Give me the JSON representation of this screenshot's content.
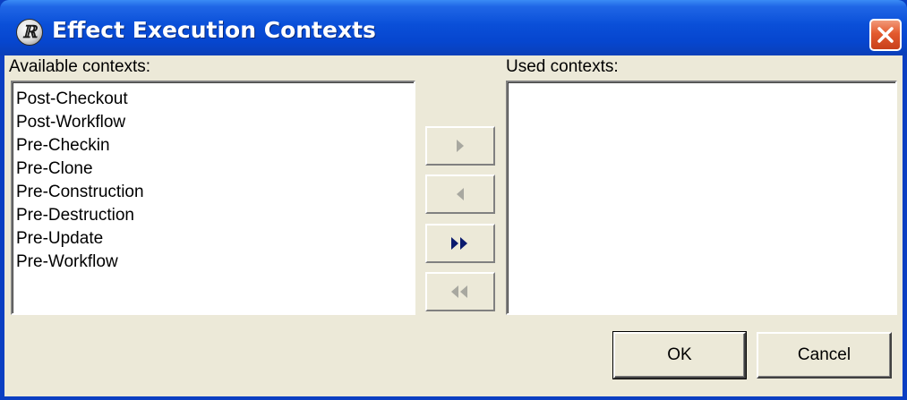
{
  "window": {
    "title": "Effect Execution Contexts"
  },
  "available": {
    "label": "Available contexts:",
    "items": [
      "Post-Checkout",
      "Post-Workflow",
      "Pre-Checkin",
      "Pre-Clone",
      "Pre-Construction",
      "Pre-Destruction",
      "Pre-Update",
      "Pre-Workflow"
    ]
  },
  "used": {
    "label": "Used contexts:",
    "items": []
  },
  "buttons": {
    "ok": "OK",
    "cancel": "Cancel"
  },
  "icons": {
    "app": "app-logo-icon",
    "close": "close-icon"
  },
  "colors": {
    "title_bar": "#0a4fd8",
    "dialog_bg": "#ece9d8",
    "close_button": "#e35a2e"
  }
}
